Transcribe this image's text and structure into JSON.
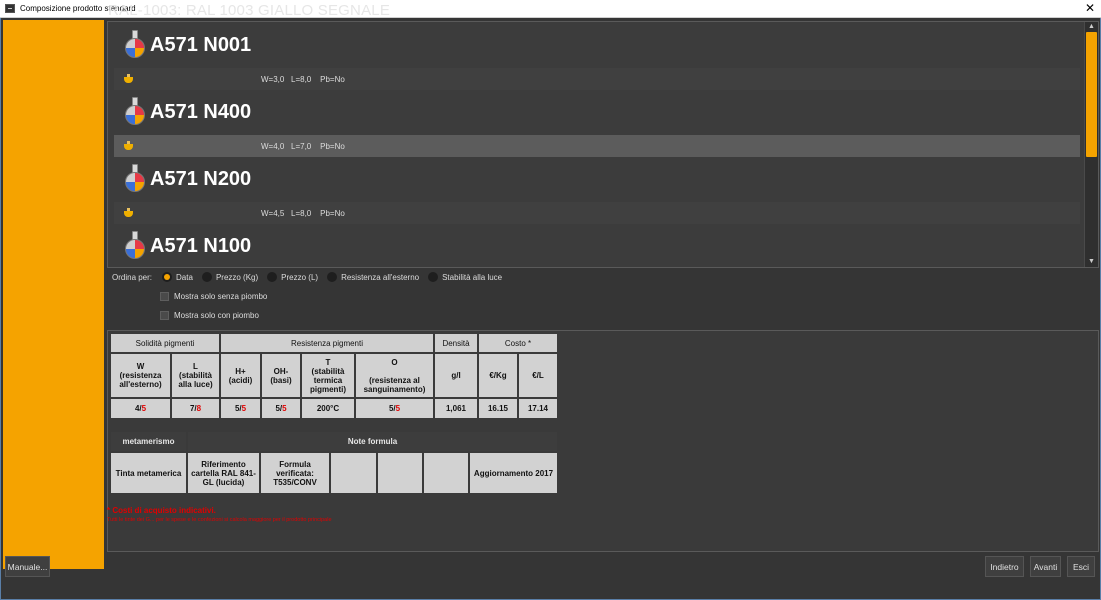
{
  "window": {
    "title": "Composizione prodotto standard",
    "close_glyph": "✕"
  },
  "header": {
    "title": "RAL-1003: RAL 1003 GIALLO SEGNALE"
  },
  "products": [
    {
      "code": "A571 N001",
      "meta": "W=3,0   L=8,0    Pb=No"
    },
    {
      "code": "A571 N400",
      "meta": "W=4,0   L=7,0    Pb=No"
    },
    {
      "code": "A571 N200",
      "meta": "W=4,5   L=8,0    Pb=No"
    },
    {
      "code": "A571 N100",
      "meta": ""
    }
  ],
  "sort": {
    "label": "Ordina per:",
    "options": [
      "Data",
      "Prezzo (Kg)",
      "Prezzo (L)",
      "Resistenza all'esterno",
      "Stabilità alla luce"
    ],
    "selected": "Data"
  },
  "filters": {
    "no_lead": "Mostra solo senza piombo",
    "with_lead": "Mostra solo con piombo"
  },
  "table": {
    "groups": {
      "solidita": "Solidità pigmenti",
      "resistenza": "Resistenza pigmenti",
      "densita": "Densità",
      "costo": "Costo *"
    },
    "columns": {
      "w": "W\n(resistenza\nall'esterno)",
      "l": "L\n(stabilità\nalla luce)",
      "h": "H+\n(acidi)",
      "oh": "OH-\n(basi)",
      "t": "T\n(stabilità\ntermica\npigmenti)",
      "o": "O\n\n(resistenza al\nsanguinamento)",
      "gl": "g/l",
      "ekg": "€/Kg",
      "el": "€/L"
    },
    "values": {
      "w_a": "4/",
      "w_b": "5",
      "l_a": "7/",
      "l_b": "8",
      "h_a": "5/",
      "h_b": "5",
      "oh_a": "5/",
      "oh_b": "5",
      "t": "200°C",
      "o_a": "5/",
      "o_b": "5",
      "gl": "1,061",
      "ekg": "16.15",
      "el": "17.14"
    }
  },
  "notes": {
    "metamerism_title": "metamerismo",
    "notes_title": "Note formula",
    "metamerism_value": "Tinta metamerica",
    "note1": "Riferimento cartella RAL 841-GL (lucida)",
    "note2": "Formula verificata: T535/CONV",
    "note6": "Aggiornamento 2017"
  },
  "footnotes": {
    "line1": "* Costi di acquisto indicativi.",
    "line2": "Tutti le tinte dei G... per le spese e le confezioni si calcola maggiore per il prodotto principale"
  },
  "buttons": {
    "manual": "Manuale...",
    "back": "Indietro",
    "next": "Avanti",
    "exit": "Esci"
  },
  "colors": {
    "accent": "#f5a300",
    "negative": "#e00000"
  }
}
